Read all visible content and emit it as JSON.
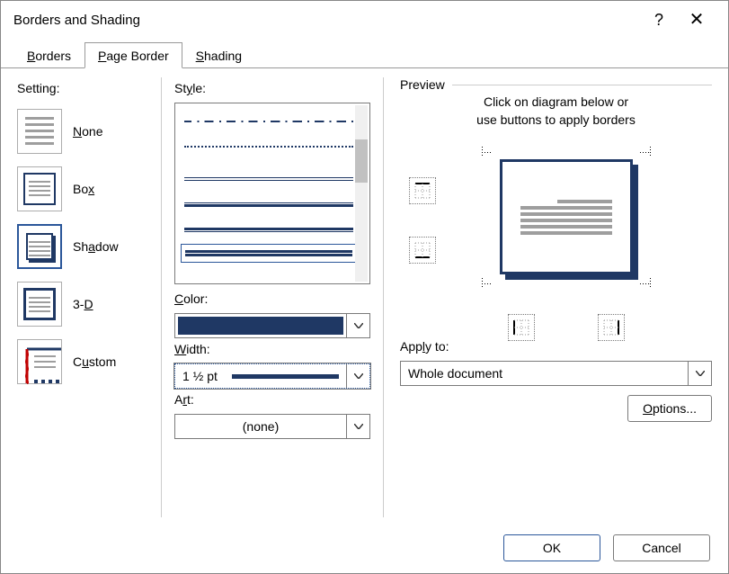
{
  "window": {
    "title": "Borders and Shading"
  },
  "tabs": {
    "borders": "Borders",
    "page_border": "Page Border",
    "shading": "Shading",
    "active": "page_border"
  },
  "settings": {
    "label": "Setting:",
    "items": [
      {
        "label": "None"
      },
      {
        "label": "Box"
      },
      {
        "label": "Shadow"
      },
      {
        "label": "3-D"
      },
      {
        "label": "Custom"
      }
    ],
    "selected_index": 2
  },
  "style": {
    "label": "Style:",
    "color_label": "Color:",
    "color_value": "#1f3864",
    "width_label": "Width:",
    "width_value": "1 ½ pt",
    "art_label": "Art:",
    "art_value": "(none)"
  },
  "preview": {
    "label": "Preview",
    "hint_line1": "Click on diagram below or",
    "hint_line2": "use buttons to apply borders",
    "apply_to_label": "Apply to:",
    "apply_to_value": "Whole document",
    "options_label": "Options..."
  },
  "footer": {
    "ok": "OK",
    "cancel": "Cancel"
  }
}
